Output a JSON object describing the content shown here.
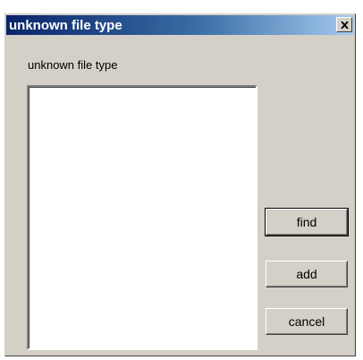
{
  "window": {
    "title": "unknown file type",
    "close_label": "X"
  },
  "content": {
    "label": "unknown file type",
    "list_items": []
  },
  "buttons": {
    "find": "find",
    "add": "add",
    "cancel": "cancel"
  }
}
